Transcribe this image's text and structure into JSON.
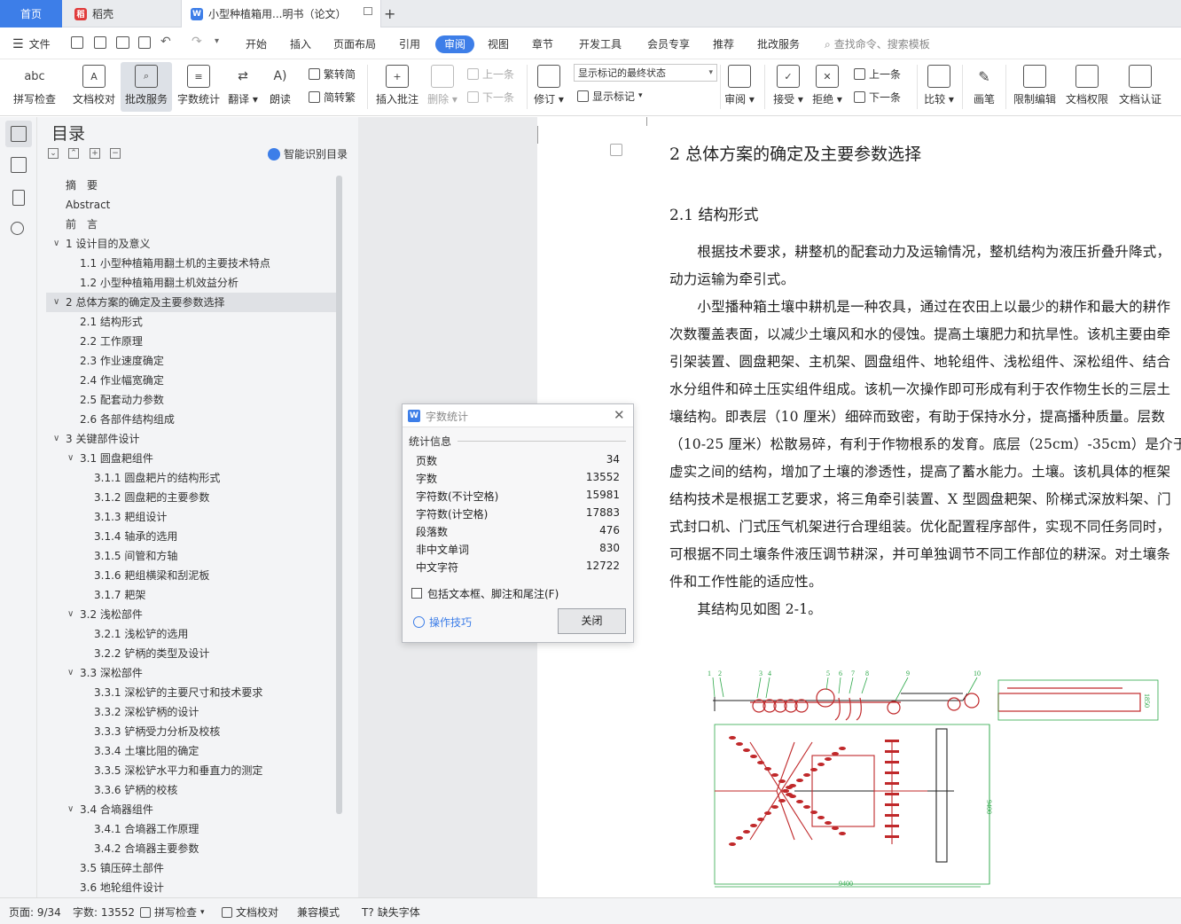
{
  "tabs": {
    "home": "首页",
    "daoke": "稻壳",
    "doc": "小型种植箱用...明书（论文）",
    "add": "+"
  },
  "menu": {
    "file": "文件",
    "items": [
      "开始",
      "插入",
      "页面布局",
      "引用",
      "审阅",
      "视图",
      "章节",
      "开发工具",
      "会员专享",
      "推荐",
      "批改服务"
    ],
    "search": "查找命令、搜索模板"
  },
  "ribbon": {
    "spell": "拼写检查",
    "proof": "文档校对",
    "approve": "批改服务",
    "count": "字数统计",
    "translate": "翻译",
    "read": "朗读",
    "t2s": "繁转简",
    "s2t": "简转繁",
    "insert_comment": "插入批注",
    "delete": "删除",
    "prev": "上一条",
    "next": "下一条",
    "track": "修订",
    "markup_state": "显示标记的最终状态",
    "show_markup": "显示标记",
    "review": "审阅",
    "accept": "接受",
    "reject": "拒绝",
    "prev2": "上一条",
    "next2": "下一条",
    "compare": "比较",
    "pen": "画笔",
    "restrict": "限制编辑",
    "perm": "文档权限",
    "cert": "文档认证"
  },
  "toc": {
    "title": "目录",
    "smart": "智能识别目录",
    "items": [
      {
        "t": "摘　要",
        "lv": 0
      },
      {
        "t": "Abstract",
        "lv": 0
      },
      {
        "t": "前　言",
        "lv": 0
      },
      {
        "t": "1 设计目的及意义",
        "lv": 0,
        "c": 1
      },
      {
        "t": "1.1 小型种植箱用翻土机的主要技术特点",
        "lv": 1
      },
      {
        "t": "1.2 小型种植箱用翻土机效益分析",
        "lv": 1
      },
      {
        "t": "2 总体方案的确定及主要参数选择",
        "lv": 0,
        "c": 1,
        "sel": 1
      },
      {
        "t": "2.1 结构形式",
        "lv": 1
      },
      {
        "t": "2.2 工作原理",
        "lv": 1
      },
      {
        "t": "2.3 作业速度确定",
        "lv": 1
      },
      {
        "t": "2.4 作业幅宽确定",
        "lv": 1
      },
      {
        "t": "2.5 配套动力参数",
        "lv": 1
      },
      {
        "t": "2.6 各部件结构组成",
        "lv": 1
      },
      {
        "t": "3 关键部件设计",
        "lv": 0,
        "c": 1
      },
      {
        "t": "3.1 圆盘耙组件",
        "lv": 1,
        "c": 1
      },
      {
        "t": "3.1.1 圆盘耙片的结构形式",
        "lv": 2
      },
      {
        "t": "3.1.2 圆盘耙的主要参数",
        "lv": 2
      },
      {
        "t": "3.1.3 耙组设计",
        "lv": 2
      },
      {
        "t": "3.1.4 轴承的选用",
        "lv": 2
      },
      {
        "t": "3.1.5 间管和方轴",
        "lv": 2
      },
      {
        "t": "3.1.6 耙组横梁和刮泥板",
        "lv": 2
      },
      {
        "t": "3.1.7 耙架",
        "lv": 2
      },
      {
        "t": "3.2 浅松部件",
        "lv": 1,
        "c": 1
      },
      {
        "t": "3.2.1 浅松铲的选用",
        "lv": 2
      },
      {
        "t": "3.2.2 铲柄的类型及设计",
        "lv": 2
      },
      {
        "t": "3.3 深松部件",
        "lv": 1,
        "c": 1
      },
      {
        "t": "3.3.1 深松铲的主要尺寸和技术要求",
        "lv": 2
      },
      {
        "t": "3.3.2 深松铲柄的设计",
        "lv": 2
      },
      {
        "t": "3.3.3 铲柄受力分析及校核",
        "lv": 2
      },
      {
        "t": "3.3.4 土壤比阻的确定",
        "lv": 2
      },
      {
        "t": "3.3.5 深松铲水平力和垂直力的测定",
        "lv": 2
      },
      {
        "t": "3.3.6 铲柄的校核",
        "lv": 2
      },
      {
        "t": "3.4 合墒器组件",
        "lv": 1,
        "c": 1
      },
      {
        "t": "3.4.1 合墒器工作原理",
        "lv": 2
      },
      {
        "t": "3.4.2 合墒器主要参数",
        "lv": 2
      },
      {
        "t": "3.5 镇压碎土部件",
        "lv": 1
      },
      {
        "t": "3.6 地轮组件设计",
        "lv": 1
      }
    ]
  },
  "doc": {
    "h2": "2 总体方案的确定及主要参数选择",
    "h21": "2.1 结构形式",
    "lines": [
      "　　根据技术要求，耕整机的配套动力及运输情况，整机结构为液压折叠升降式，",
      "动力运输为牵引式。",
      "　　小型播种箱土壤中耕机是一种农具，通过在农田上以最少的耕作和最大的耕作",
      "次数覆盖表面，以减少土壤风和水的侵蚀。提高土壤肥力和抗旱性。该机主要由牵",
      "引架装置、圆盘耙架、主机架、圆盘组件、地轮组件、浅松组件、深松组件、结合",
      "水分组件和碎土压实组件组成。该机一次操作即可形成有利于农作物生长的三层土",
      "壤结构。即表层（10 厘米）细碎而致密，有助于保持水分，提高播种质量。层数",
      "（10-25 厘米）松散易碎，有利于作物根系的发育。底层（25cm）-35cm）是介于",
      "虚实之间的结构，增加了土壤的渗透性，提高了蓄水能力。土壤。该机具体的框架",
      "结构技术是根据工艺要求，将三角牵引装置、X 型圆盘耙架、阶梯式深放料架、门",
      "式封口机、门式压气机架进行合理组装。优化配置程序部件，实现不同任务同时，",
      "可根据不同土壤条件液压调节耕深，并可单独调节不同工作部位的耕深。对土壤条",
      "件和工作性能的适应性。",
      "　　其结构见如图 2-1。"
    ],
    "fig": {
      "callouts": [
        "1",
        "2",
        "3",
        "4",
        "5",
        "6",
        "7",
        "8",
        "9",
        "10"
      ],
      "dim_h": "9400",
      "dim_v": "9400",
      "dim_side": "1850"
    }
  },
  "dialog": {
    "title": "字数统计",
    "section": "统计信息",
    "rows": [
      {
        "k": "页数",
        "v": "34"
      },
      {
        "k": "字数",
        "v": "13552"
      },
      {
        "k": "字符数(不计空格)",
        "v": "15981"
      },
      {
        "k": "字符数(计空格)",
        "v": "17883"
      },
      {
        "k": "段落数",
        "v": "476"
      },
      {
        "k": "非中文单词",
        "v": "830"
      },
      {
        "k": "中文字符",
        "v": "12722"
      }
    ],
    "checkbox": "包括文本框、脚注和尾注(F)",
    "tips": "操作技巧",
    "close": "关闭"
  },
  "status": {
    "page": "页面: 9/34",
    "words": "字数: 13552",
    "spell": "拼写检查",
    "proof": "文档校对",
    "compat": "兼容模式",
    "font": "缺失字体"
  },
  "colors": {
    "accent": "#3d7ee8",
    "drawing_red": "#c0282a",
    "drawing_green": "#2ea84a"
  }
}
